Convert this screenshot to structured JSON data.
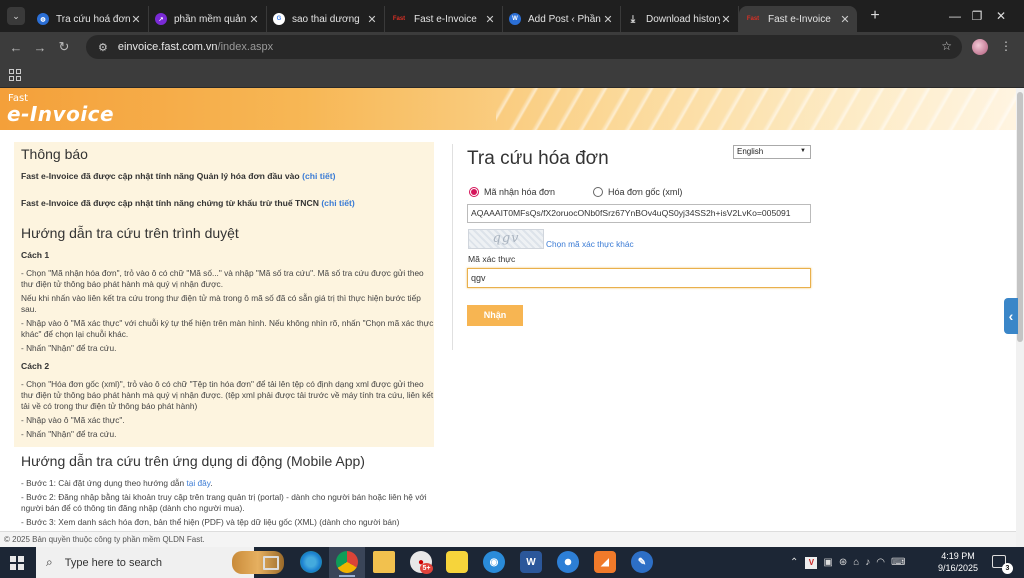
{
  "browser": {
    "tabs": [
      {
        "label": "Tra cứu hoá đơn",
        "icon": "globe-icon",
        "color": "#2b6fd6"
      },
      {
        "label": "phần mềm quản lý",
        "icon": "chart-icon",
        "color": "#7a2ad6"
      },
      {
        "label": "sao thai dương",
        "icon": "google-icon",
        "color": "#4285f4"
      },
      {
        "label": "Fast e-Invoice",
        "icon": "fast-icon",
        "color": "#d93025"
      },
      {
        "label": "Add Post ‹ Phần",
        "icon": "wordpress-icon",
        "color": "#2b6fd6"
      },
      {
        "label": "Download history",
        "icon": "download-icon",
        "color": "#555555"
      },
      {
        "label": "Fast e-Invoice",
        "icon": "fast-icon",
        "color": "#d93025"
      }
    ],
    "favicon_fast_text": "Fast",
    "url_host": "einvoice.fast.com.vn",
    "url_path": "/index.aspx"
  },
  "banner": {
    "brand_small": "Fast",
    "brand_big": "e-Invoice"
  },
  "left": {
    "notice_title": "Thông báo",
    "notice1_text": "Fast e-Invoice đã được cập nhật tính năng Quản lý hóa đơn đầu vào",
    "notice1_link": "(chi tiết)",
    "notice2_text": "Fast e-Invoice đã được cập nhật tính năng chứng từ khấu trừ thuế TNCN",
    "notice2_link": "(chi tiết)",
    "browser_guide_title": "Hướng dẫn tra cứu trên trình duyệt",
    "cach1": "Cách 1",
    "c1_p1": "- Chọn \"Mã nhận hóa đơn\", trỏ vào ô có chữ \"Mã số...\" và nhập \"Mã số tra cứu\". Mã số tra cứu được gửi theo thư điện tử thông báo phát hành mà quý vị nhận được.",
    "c1_p2": "Nếu khi nhấn vào liên kết tra cứu trong thư điện tử mà trong ô mã số đã có sẵn giá trị thì thực hiện bước tiếp sau.",
    "c1_p3": "- Nhập vào ô \"Mã xác thực\" với chuỗi ký tự thể hiện trên màn hình. Nếu không nhìn rõ, nhấn \"Chọn mã xác thực khác\" để chọn lại chuỗi khác.",
    "c1_p4": "- Nhấn \"Nhận\" để tra cứu.",
    "cach2": "Cách 2",
    "c2_p1": "- Chọn \"Hóa đơn gốc (xml)\", trỏ vào ô có chữ \"Tệp tin hóa đơn\" để tải lên tệp có định dạng xml được gửi theo thư điện tử thông báo phát hành mà quý vị nhận được. (tệp xml phải được tải trước về máy tính tra cứu, liên kết tải về có trong thư điện tử thông báo phát hành)",
    "c2_p2": "- Nhập vào ô \"Mã xác thực\".",
    "c2_p3": "- Nhấn \"Nhận\" để tra cứu.",
    "mobile_guide_title": "Hướng dẫn tra cứu trên ứng dụng di động (Mobile App)",
    "m_p1_text": "- Bước 1: Cài đặt ứng dụng theo hướng dẫn",
    "m_p1_link": "tại đây",
    "m_p1_end": ".",
    "m_p2": "- Bước 2: Đăng nhập bằng tài khoản truy cập trên trang quản trị (portal) - dành cho người bán hoặc liên hệ với người bán để có thông tin đăng nhập (dành cho người mua).",
    "m_p3": "- Bước 3: Xem danh sách hóa đơn, bản thể hiện (PDF) và tệp dữ liệu gốc (XML) (dành cho người bán)"
  },
  "right": {
    "title": "Tra cứu hóa đơn",
    "language": "English",
    "radio1": "Mã nhận hóa đơn",
    "radio2": "Hóa đơn gốc (xml)",
    "code_value": "AQAAAIT0MFsQs/fX2oruocONb0fSrz67YnBOv4uQS0yj34SS2h+isV2LvKo=005091",
    "captcha_text": "qgv",
    "captcha_link": "Chọn mã xác thực khác",
    "verify_label": "Mã xác thực",
    "verify_value": "qgv",
    "submit": "Nhận"
  },
  "footer": "© 2025 Bản quyền thuộc công ty phần mềm QLDN Fast.",
  "taskbar": {
    "search_placeholder": "Type here to search",
    "mail_badge": "5+",
    "time": "4:19 PM",
    "date": "9/16/2025",
    "notif_count": "3"
  },
  "colors": {
    "accent_orange": "#f7b552",
    "link_blue": "#3a7bd5",
    "radio_pink": "#d4145a"
  }
}
